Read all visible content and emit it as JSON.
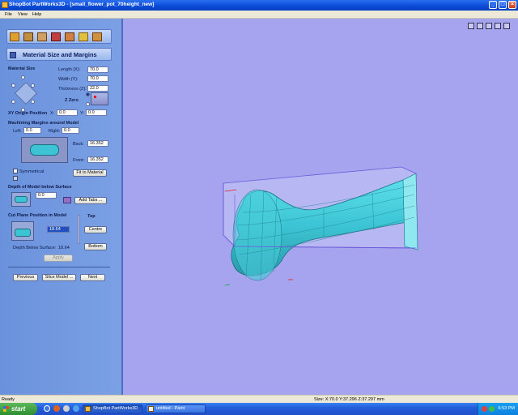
{
  "window": {
    "title": "ShopBot PartWorks3D - [small_flower_pot_70height_new]",
    "buttons": {
      "minimize": "_",
      "maximize": "□",
      "close": "×"
    }
  },
  "menu": [
    "File",
    "View",
    "Help"
  ],
  "panel": {
    "section_title": "Material Size and Margins",
    "material_size_label": "Material Size",
    "length_label": "Length (X):",
    "length_value": "70.0",
    "width_label": "Width (Y):",
    "width_value": "70.0",
    "thickness_label": "Thickness (Z):",
    "thickness_value": "22.0",
    "zzero_label": "Z Zero",
    "xy_origin_label": "XY Origin Position",
    "x_label": "X:",
    "x_value": "0.0",
    "y_label": "Y:",
    "y_value": "0.0",
    "margins_label": "Machining Margins around Model",
    "left_label": "Left:",
    "left_value": "0.0",
    "right_label": "Right:",
    "right_value": "0.0",
    "back_label": "Back:",
    "back_value": "16.352",
    "front_label": "Front:",
    "front_value": "16.352",
    "symmetrical_label": "Symmetrical",
    "fit_button": "Fit to Material",
    "depth_label": "Depth of Model below Surface",
    "depth_value": "0.0",
    "add_tabs_button": "Add Tabs ...",
    "cut_plane_label": "Cut Plane Position in Model",
    "cut_plane_value": "18.64",
    "top_label": "Top",
    "centre_button": "Centre",
    "bottom_button": "Bottom",
    "depth_below_label": "Depth Below Surface:",
    "depth_below_value": "18.64",
    "apply_button": "Apply",
    "previous_button": "Previous",
    "slice_button": "Slice Model ...",
    "next_button": "Next"
  },
  "status": {
    "left": "Ready",
    "size": "Size: X:70.0 Y:37.296 Z:37.297 mm"
  },
  "taskbar": {
    "start": "start",
    "tasks": [
      "ShopBot PartWorks3D",
      "untitled - Paint"
    ],
    "clock": "6:53 PM"
  },
  "colors": {
    "viewport_bg": "#a6a4ef",
    "panel_bg": "#6a92dc",
    "model_cyan": "#3cc4d4",
    "bbox": "#6a5ad8"
  }
}
